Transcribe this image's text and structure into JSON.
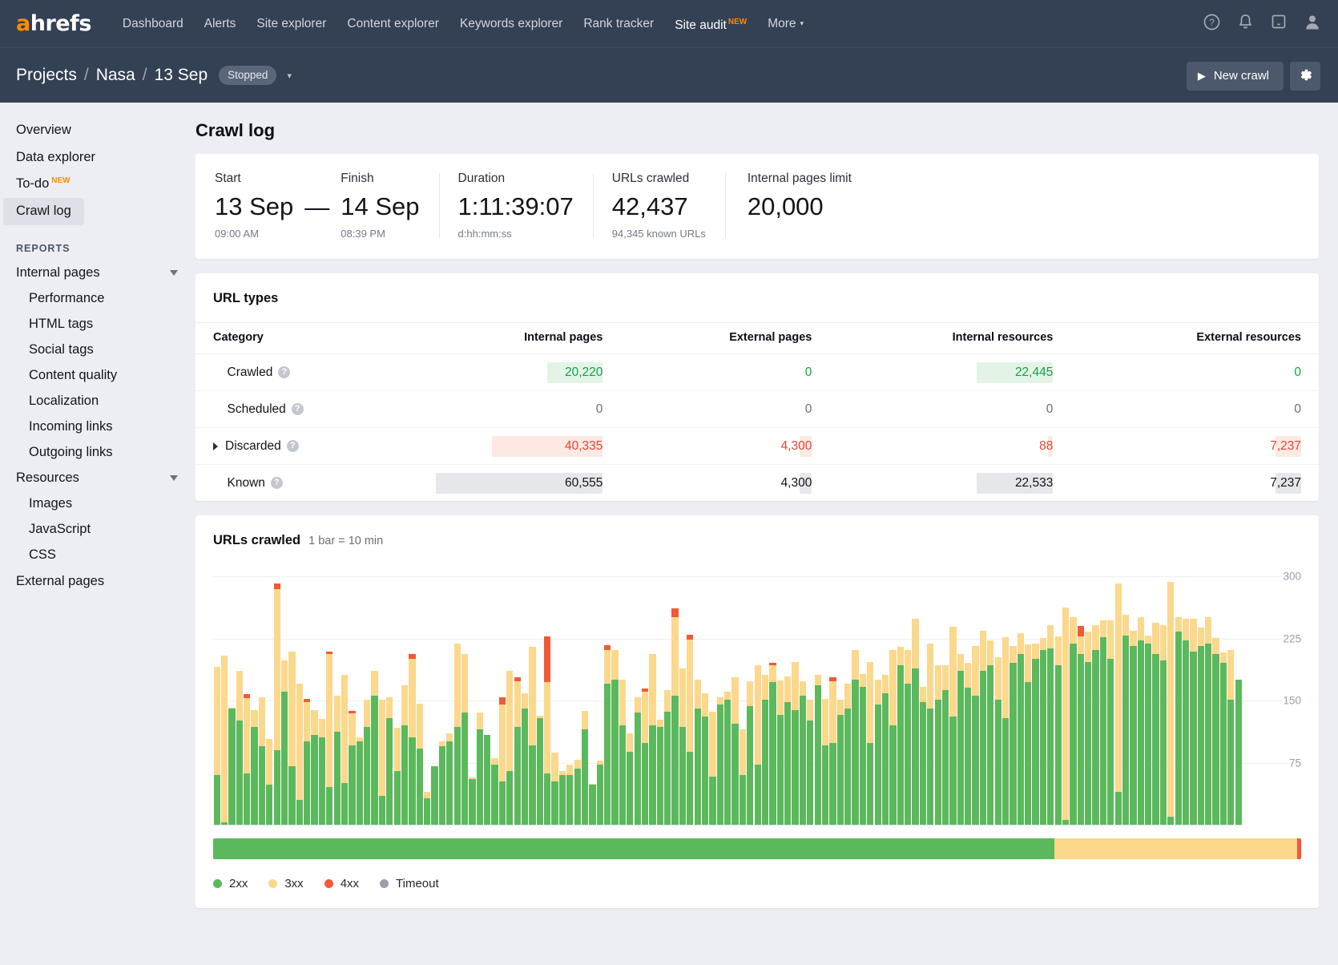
{
  "topnav": {
    "logo": "ahrefs",
    "items": [
      {
        "label": "Dashboard",
        "active": false
      },
      {
        "label": "Alerts",
        "active": false
      },
      {
        "label": "Site explorer",
        "active": false
      },
      {
        "label": "Content explorer",
        "active": false
      },
      {
        "label": "Keywords explorer",
        "active": false
      },
      {
        "label": "Rank tracker",
        "active": false
      },
      {
        "label": "Site audit",
        "active": true,
        "badge": "NEW"
      },
      {
        "label": "More",
        "active": false,
        "caret": "▾"
      }
    ],
    "icons": [
      "help-icon",
      "bell-icon",
      "chat-icon",
      "user-icon"
    ]
  },
  "breadcrumb": {
    "projects": "Projects",
    "sep1": "/",
    "site": "Nasa",
    "sep2": "/",
    "date": "13 Sep",
    "status": "Stopped",
    "caret": "▾",
    "new_crawl": "New crawl",
    "play_icon": "▶",
    "gear_icon": "gear-icon"
  },
  "sidebar": {
    "top_items": [
      {
        "label": "Overview",
        "selected": false
      },
      {
        "label": "Data explorer",
        "selected": false
      },
      {
        "label": "To-do",
        "selected": false,
        "badge": "NEW"
      },
      {
        "label": "Crawl log",
        "selected": true
      }
    ],
    "section_title": "REPORTS",
    "groups": [
      {
        "label": "Internal pages",
        "expanded": true,
        "children": [
          "Performance",
          "HTML tags",
          "Social tags",
          "Content quality",
          "Localization",
          "Incoming links",
          "Outgoing links"
        ]
      },
      {
        "label": "Resources",
        "expanded": true,
        "children": [
          "Images",
          "JavaScript",
          "CSS"
        ]
      }
    ],
    "bottom_items": [
      {
        "label": "External pages",
        "selected": false
      }
    ]
  },
  "page": {
    "title": "Crawl log"
  },
  "summary": {
    "start": {
      "label": "Start",
      "value": "13 Sep",
      "sub": "09:00 AM"
    },
    "dash": "—",
    "finish": {
      "label": "Finish",
      "value": "14 Sep",
      "sub": "08:39 PM"
    },
    "duration": {
      "label": "Duration",
      "value": "1:11:39:07",
      "sub": "d:hh:mm:ss"
    },
    "urls_crawled": {
      "label": "URLs crawled",
      "value": "42,437",
      "sub": "94,345 known URLs"
    },
    "limit": {
      "label": "Internal pages limit",
      "value": "20,000",
      "sub": ""
    }
  },
  "url_types": {
    "title": "URL types",
    "columns": [
      "Category",
      "Internal pages",
      "External pages",
      "Internal resources",
      "External resources"
    ],
    "rows": [
      {
        "category": "Crawled",
        "expandable": false,
        "help": "?",
        "cells": [
          {
            "text": "20,220",
            "tone": "g",
            "bar_pct": 33.4,
            "bar_color": "#e3f4e6"
          },
          {
            "text": "0",
            "tone": "g",
            "bar_pct": 0,
            "bar_color": "#e3f4e6"
          },
          {
            "text": "22,445",
            "tone": "g",
            "bar_pct": 37.1,
            "bar_color": "#e3f4e6"
          },
          {
            "text": "0",
            "tone": "g",
            "bar_pct": 0,
            "bar_color": "#e3f4e6"
          }
        ]
      },
      {
        "category": "Scheduled",
        "expandable": false,
        "help": "?",
        "cells": [
          {
            "text": "0",
            "tone": "zero",
            "bar_pct": 0,
            "bar_color": "#f2f3f5"
          },
          {
            "text": "0",
            "tone": "zero",
            "bar_pct": 0,
            "bar_color": "#f2f3f5"
          },
          {
            "text": "0",
            "tone": "zero",
            "bar_pct": 0,
            "bar_color": "#f2f3f5"
          },
          {
            "text": "0",
            "tone": "zero",
            "bar_pct": 0,
            "bar_color": "#f2f3f5"
          }
        ]
      },
      {
        "category": "Discarded",
        "expandable": true,
        "help": "?",
        "cells": [
          {
            "text": "40,335",
            "tone": "r",
            "bar_pct": 66.6,
            "bar_color": "#fde8e4"
          },
          {
            "text": "4,300",
            "tone": "r",
            "bar_pct": 7.1,
            "bar_color": "#fde8e4"
          },
          {
            "text": "88",
            "tone": "r",
            "bar_pct": 0.15,
            "bar_color": "#fde8e4"
          },
          {
            "text": "7,237",
            "tone": "r",
            "bar_pct": 12.0,
            "bar_color": "#fde8e4"
          }
        ]
      },
      {
        "category": "Known",
        "expandable": false,
        "help": "?",
        "cells": [
          {
            "text": "60,555",
            "tone": "d",
            "bar_pct": 100,
            "bar_color": "#e6e7ea"
          },
          {
            "text": "4,300",
            "tone": "d",
            "bar_pct": 7.1,
            "bar_color": "#e6e7ea"
          },
          {
            "text": "22,533",
            "tone": "d",
            "bar_pct": 37.2,
            "bar_color": "#e6e7ea"
          },
          {
            "text": "7,237",
            "tone": "d",
            "bar_pct": 12.0,
            "bar_color": "#e6e7ea"
          }
        ]
      }
    ]
  },
  "chart_card": {
    "title": "URLs crawled",
    "subtitle": "1 bar = 10 min",
    "legend": [
      {
        "label": "2xx",
        "color": "#5cb85c"
      },
      {
        "label": "3xx",
        "color": "#fbd88b"
      },
      {
        "label": "4xx",
        "color": "#f05a38"
      },
      {
        "label": "Timeout",
        "color": "#9aa0a9"
      }
    ],
    "progress_bar": [
      {
        "label": "2xx",
        "color": "#5cb85c",
        "pct": 77.3
      },
      {
        "label": "3xx",
        "color": "#fbd88b",
        "pct": 22.3
      },
      {
        "label": "4xx",
        "color": "#f05a38",
        "pct": 0.4
      }
    ]
  },
  "chart_data": {
    "type": "bar",
    "title": "URLs crawled",
    "subtitle": "1 bar = 10 min",
    "stacked": true,
    "xlabel": "",
    "ylabel": "",
    "ylim": [
      0,
      320
    ],
    "yticks": [
      75,
      150,
      225,
      300
    ],
    "ytick_labels": [
      "75",
      "150",
      "225",
      "300"
    ],
    "grid": true,
    "legend_position": "bottom-left",
    "series": [
      {
        "name": "2xx",
        "color": "#5cb85c"
      },
      {
        "name": "3xx",
        "color": "#fbd88b"
      },
      {
        "name": "4xx",
        "color": "#f05a38"
      },
      {
        "name": "Timeout",
        "color": "#9aa0a9"
      }
    ],
    "bars": [
      [
        60,
        130,
        0
      ],
      [
        3,
        200,
        0
      ],
      [
        140,
        1,
        0
      ],
      [
        125,
        60,
        0
      ],
      [
        62,
        90,
        5
      ],
      [
        118,
        20,
        0
      ],
      [
        95,
        58,
        0
      ],
      [
        48,
        55,
        0
      ],
      [
        90,
        193,
        7
      ],
      [
        160,
        38,
        0
      ],
      [
        70,
        138,
        0
      ],
      [
        30,
        140,
        0
      ],
      [
        100,
        48,
        3
      ],
      [
        108,
        30,
        0
      ],
      [
        105,
        22,
        0
      ],
      [
        45,
        160,
        3
      ],
      [
        112,
        43,
        0
      ],
      [
        50,
        130,
        0
      ],
      [
        96,
        38,
        3
      ],
      [
        100,
        5,
        0
      ],
      [
        118,
        32,
        0
      ],
      [
        155,
        30,
        0
      ],
      [
        35,
        115,
        0
      ],
      [
        128,
        25,
        0
      ],
      [
        65,
        52,
        0
      ],
      [
        120,
        48,
        0
      ],
      [
        105,
        95,
        5
      ],
      [
        92,
        54,
        0
      ],
      [
        32,
        8,
        0
      ],
      [
        70,
        0,
        0
      ],
      [
        95,
        5,
        0
      ],
      [
        100,
        10,
        0
      ],
      [
        118,
        100,
        0
      ],
      [
        135,
        70,
        0
      ],
      [
        55,
        2,
        0
      ],
      [
        115,
        20,
        0
      ],
      [
        108,
        0,
        0
      ],
      [
        72,
        8,
        0
      ],
      [
        52,
        93,
        8
      ],
      [
        65,
        120,
        0
      ],
      [
        118,
        55,
        4
      ],
      [
        140,
        18,
        0
      ],
      [
        96,
        118,
        0
      ],
      [
        128,
        3,
        0
      ],
      [
        62,
        110,
        55
      ],
      [
        52,
        35,
        0
      ],
      [
        60,
        5,
        0
      ],
      [
        60,
        12,
        0
      ],
      [
        68,
        10,
        0
      ],
      [
        115,
        22,
        0
      ],
      [
        48,
        1,
        0
      ],
      [
        72,
        5,
        0
      ],
      [
        170,
        40,
        6
      ],
      [
        175,
        35,
        0
      ],
      [
        120,
        55,
        0
      ],
      [
        88,
        22,
        0
      ],
      [
        135,
        18,
        0
      ],
      [
        98,
        62,
        4
      ],
      [
        120,
        85,
        0
      ],
      [
        118,
        8,
        0
      ],
      [
        136,
        26,
        0
      ],
      [
        155,
        95,
        10
      ],
      [
        118,
        70,
        0
      ],
      [
        88,
        135,
        6
      ],
      [
        140,
        35,
        0
      ],
      [
        130,
        28,
        0
      ],
      [
        58,
        78,
        0
      ],
      [
        145,
        8,
        0
      ],
      [
        150,
        10,
        0
      ],
      [
        122,
        55,
        0
      ],
      [
        60,
        55,
        0
      ],
      [
        143,
        30,
        0
      ],
      [
        72,
        120,
        0
      ],
      [
        150,
        30,
        0
      ],
      [
        172,
        20,
        3
      ],
      [
        132,
        42,
        0
      ],
      [
        148,
        30,
        0
      ],
      [
        138,
        58,
        0
      ],
      [
        155,
        18,
        0
      ],
      [
        125,
        25,
        0
      ],
      [
        168,
        12,
        0
      ],
      [
        96,
        55,
        0
      ],
      [
        98,
        75,
        4
      ],
      [
        132,
        18,
        0
      ],
      [
        140,
        30,
        0
      ],
      [
        175,
        35,
        0
      ],
      [
        166,
        15,
        0
      ],
      [
        98,
        98,
        0
      ],
      [
        145,
        30,
        0
      ],
      [
        158,
        22,
        0
      ],
      [
        120,
        90,
        0
      ],
      [
        192,
        22,
        0
      ],
      [
        170,
        40,
        0
      ],
      [
        188,
        60,
        0
      ],
      [
        148,
        18,
        0
      ],
      [
        140,
        78,
        0
      ],
      [
        150,
        42,
        0
      ],
      [
        162,
        30,
        0
      ],
      [
        130,
        108,
        0
      ],
      [
        185,
        20,
        0
      ],
      [
        165,
        30,
        0
      ],
      [
        155,
        60,
        0
      ],
      [
        185,
        48,
        0
      ],
      [
        192,
        30,
        0
      ],
      [
        150,
        52,
        0
      ],
      [
        128,
        98,
        0
      ],
      [
        195,
        20,
        0
      ],
      [
        205,
        25,
        0
      ],
      [
        172,
        45,
        0
      ],
      [
        200,
        18,
        0
      ],
      [
        210,
        15,
        0
      ],
      [
        212,
        28,
        0
      ],
      [
        192,
        35,
        0
      ],
      [
        6,
        255,
        0
      ],
      [
        218,
        32,
        0
      ],
      [
        205,
        22,
        12
      ],
      [
        196,
        36,
        0
      ],
      [
        210,
        30,
        0
      ],
      [
        226,
        20,
        0
      ],
      [
        200,
        46,
        0
      ],
      [
        40,
        250,
        0
      ],
      [
        228,
        25,
        0
      ],
      [
        215,
        18,
        0
      ],
      [
        222,
        28,
        0
      ],
      [
        218,
        10,
        0
      ],
      [
        205,
        38,
        0
      ],
      [
        198,
        42,
        0
      ],
      [
        10,
        282,
        0
      ],
      [
        232,
        18,
        0
      ],
      [
        222,
        26,
        0
      ],
      [
        208,
        40,
        0
      ],
      [
        215,
        22,
        0
      ],
      [
        218,
        32,
        0
      ],
      [
        205,
        20,
        0
      ],
      [
        195,
        12,
        0
      ],
      [
        150,
        60,
        0
      ],
      [
        175,
        0,
        0
      ]
    ]
  }
}
